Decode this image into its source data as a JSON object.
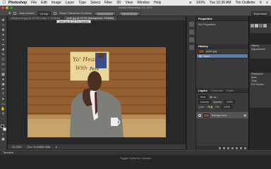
{
  "menubar": {
    "app": "Photoshop",
    "items": [
      "File",
      "Edit",
      "Image",
      "Layer",
      "Type",
      "Select",
      "Filter",
      "3D",
      "View",
      "Window",
      "Help"
    ],
    "battery": "100%",
    "clock": "Tue 10:30 AM",
    "user": "Tim Ouillette"
  },
  "window": {
    "title": "Adobe Photoshop CC 2014"
  },
  "options": {
    "auto_select_label": "Auto-Select:",
    "auto_select_value": "Group",
    "show_transform": "Show Transform Controls",
    "workspace": "Essentials"
  },
  "tabs": [
    {
      "label": "ellie@pexel.jpg @ 33.3% (Layer 1, RGB/8#)",
      "active": false
    },
    {
      "label": "yeah.jpg @ 33.3% (Background, RGB/8#)",
      "active": true
    }
  ],
  "tab_tooltip": "yeah.jpg @ 33.3% (Adobe)",
  "status": {
    "zoom": "33.33%",
    "doc": "Doc: 5.93M/5.93M"
  },
  "canvas_image": {
    "sign_line1": "Ya' Heard?",
    "sign_line2": "With",
    "sign_line3": "Pere"
  },
  "timeline": {
    "title": "Timeline",
    "center_text": "Toggle Switches / Modes"
  },
  "properties": {
    "title": "Properties",
    "body": "No Properties"
  },
  "history": {
    "title": "History",
    "items": [
      {
        "label": "yeah.jpg",
        "selected": false
      },
      {
        "label": "Open",
        "selected": true
      }
    ]
  },
  "layers": {
    "tabs": [
      "Layers",
      "Channels",
      "Paths"
    ],
    "kind": "Kind",
    "blend": "Normal",
    "opacity_label": "Opacity:",
    "opacity": "100%",
    "lock_label": "Lock:",
    "fill_label": "Fill:",
    "fill": "100%",
    "rows": [
      {
        "name": "Background"
      }
    ]
  },
  "right_peek": {
    "a": "History",
    "b": "Adjustments",
    "c": "Resolution",
    "d": "Auto",
    "e": "Tone",
    "f": "Full Screen"
  },
  "colors": {
    "accent": "#5a7faa",
    "canvas_bg": "#8b5a2b"
  }
}
